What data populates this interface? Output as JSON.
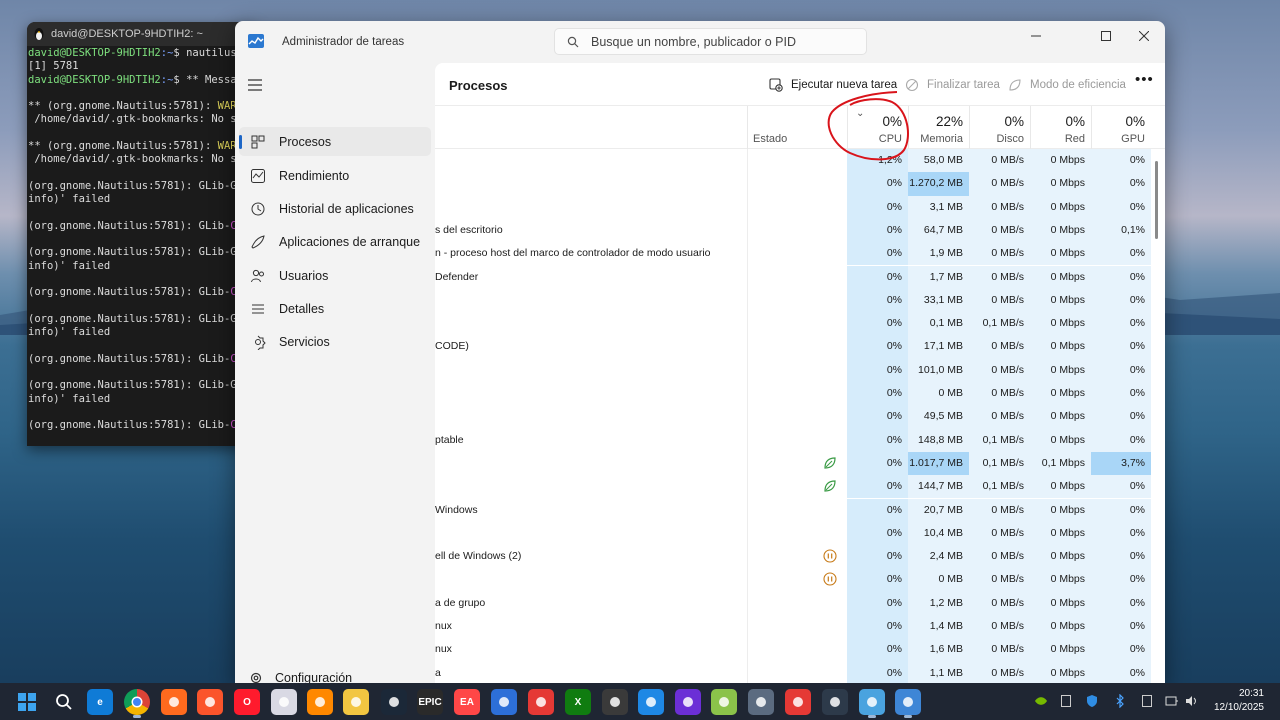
{
  "terminal": {
    "title": "david@DESKTOP-9HDTIH2: ~",
    "lines": [
      {
        "prompt_user": "david@DESKTOP-9HDTIH2",
        "prompt_path": ":~",
        "rest": "$ nautilus &"
      },
      {
        "text": "[1] 5781"
      },
      {
        "prompt_user": "david@DESKTOP-9HDTIH2",
        "prompt_path": ":~",
        "rest": "$ ** Message"
      },
      {
        "text": ""
      },
      {
        "pre": "** (org.gnome.Nautilus:5781): ",
        "warn": "WARNI"
      },
      {
        "text": " /home/david/.gtk-bookmarks: No suc"
      },
      {
        "text": ""
      },
      {
        "pre": "** (org.gnome.Nautilus:5781): ",
        "warn": "WARNI"
      },
      {
        "text": " /home/david/.gtk-bookmarks: No suc"
      },
      {
        "text": ""
      },
      {
        "pre": "(org.gnome.Nautilus:5781): GLib-GIC",
        "warn": ""
      },
      {
        "text": "info)' failed"
      },
      {
        "text": ""
      },
      {
        "pre": "(org.gnome.Nautilus:5781): GLib-",
        "crit": "CRI"
      },
      {
        "text": ""
      },
      {
        "pre": "(org.gnome.Nautilus:5781): GLib-GIC",
        "warn": ""
      },
      {
        "text": "info)' failed"
      },
      {
        "text": ""
      },
      {
        "pre": "(org.gnome.Nautilus:5781): GLib-",
        "crit": "CRI"
      },
      {
        "text": ""
      },
      {
        "pre": "(org.gnome.Nautilus:5781): GLib-GIC",
        "warn": ""
      },
      {
        "text": "info)' failed"
      },
      {
        "text": ""
      },
      {
        "pre": "(org.gnome.Nautilus:5781): GLib-",
        "crit": "CRI"
      },
      {
        "text": ""
      },
      {
        "pre": "(org.gnome.Nautilus:5781): GLib-GIC",
        "warn": ""
      },
      {
        "text": "info)' failed"
      },
      {
        "text": ""
      },
      {
        "pre": "(org.gnome.Nautilus:5781): GLib-",
        "crit": "CRI"
      }
    ]
  },
  "taskmgr": {
    "title": "Administrador de tareas",
    "search_placeholder": "Busque un nombre, publicador o PID",
    "nav": [
      {
        "label": "Procesos",
        "icon": "processes-icon",
        "active": true
      },
      {
        "label": "Rendimiento",
        "icon": "performance-icon"
      },
      {
        "label": "Historial de aplicaciones",
        "icon": "history-icon"
      },
      {
        "label": "Aplicaciones de arranque",
        "icon": "startup-icon"
      },
      {
        "label": "Usuarios",
        "icon": "users-icon"
      },
      {
        "label": "Detalles",
        "icon": "details-icon"
      },
      {
        "label": "Servicios",
        "icon": "services-icon"
      }
    ],
    "settings_label": "Configuración",
    "page_title": "Procesos",
    "toolbar": {
      "run_new_task": "Ejecutar nueva tarea",
      "end_task": "Finalizar tarea",
      "efficiency_mode": "Modo de eficiencia",
      "more": "•••"
    },
    "columns": {
      "status": "Estado",
      "cpu": {
        "pct": "0%",
        "label": "CPU"
      },
      "memory": {
        "pct": "22%",
        "label": "Memoria"
      },
      "disk": {
        "pct": "0%",
        "label": "Disco"
      },
      "network": {
        "pct": "0%",
        "label": "Red"
      },
      "gpu": {
        "pct": "0%",
        "label": "GPU"
      }
    },
    "rows": [
      {
        "name": "",
        "status": "",
        "cpu": "1,2%",
        "mem": "58,0 MB",
        "disk": "0 MB/s",
        "net": "0 Mbps",
        "gpu": "0%"
      },
      {
        "name": "",
        "status": "",
        "cpu": "0%",
        "mem": "1.270,2 MB",
        "disk": "0 MB/s",
        "net": "0 Mbps",
        "gpu": "0%",
        "mem_hl": true
      },
      {
        "name": "",
        "status": "",
        "cpu": "0%",
        "mem": "3,1 MB",
        "disk": "0 MB/s",
        "net": "0 Mbps",
        "gpu": "0%"
      },
      {
        "name": "s del escritorio",
        "status": "",
        "cpu": "0%",
        "mem": "64,7 MB",
        "disk": "0 MB/s",
        "net": "0 Mbps",
        "gpu": "0,1%"
      },
      {
        "name": "n - proceso host del marco de controlador de modo usuario",
        "status": "",
        "cpu": "0%",
        "mem": "1,9 MB",
        "disk": "0 MB/s",
        "net": "0 Mbps",
        "gpu": "0%"
      },
      {
        "name": "Defender",
        "status": "",
        "cpu": "0%",
        "mem": "1,7 MB",
        "disk": "0 MB/s",
        "net": "0 Mbps",
        "gpu": "0%"
      },
      {
        "name": "",
        "status": "",
        "cpu": "0%",
        "mem": "33,1 MB",
        "disk": "0 MB/s",
        "net": "0 Mbps",
        "gpu": "0%"
      },
      {
        "name": "",
        "status": "",
        "cpu": "0%",
        "mem": "0,1 MB",
        "disk": "0,1 MB/s",
        "net": "0 Mbps",
        "gpu": "0%"
      },
      {
        "name": "CODE)",
        "status": "",
        "cpu": "0%",
        "mem": "17,1 MB",
        "disk": "0 MB/s",
        "net": "0 Mbps",
        "gpu": "0%"
      },
      {
        "name": "",
        "status": "",
        "cpu": "0%",
        "mem": "101,0 MB",
        "disk": "0 MB/s",
        "net": "0 Mbps",
        "gpu": "0%"
      },
      {
        "name": "",
        "status": "",
        "cpu": "0%",
        "mem": "0 MB",
        "disk": "0 MB/s",
        "net": "0 Mbps",
        "gpu": "0%"
      },
      {
        "name": "",
        "status": "",
        "cpu": "0%",
        "mem": "49,5 MB",
        "disk": "0 MB/s",
        "net": "0 Mbps",
        "gpu": "0%"
      },
      {
        "name": "ptable",
        "status": "",
        "cpu": "0%",
        "mem": "148,8 MB",
        "disk": "0,1 MB/s",
        "net": "0 Mbps",
        "gpu": "0%"
      },
      {
        "name": "",
        "status": "leaf",
        "cpu": "0%",
        "mem": "1.017,7 MB",
        "disk": "0,1 MB/s",
        "net": "0,1 Mbps",
        "gpu": "3,7%",
        "mem_hl": true,
        "gpu_hl": true
      },
      {
        "name": "",
        "status": "leaf",
        "cpu": "0%",
        "mem": "144,7 MB",
        "disk": "0,1 MB/s",
        "net": "0 Mbps",
        "gpu": "0%"
      },
      {
        "name": "Windows",
        "status": "",
        "cpu": "0%",
        "mem": "20,7 MB",
        "disk": "0 MB/s",
        "net": "0 Mbps",
        "gpu": "0%"
      },
      {
        "name": "",
        "status": "",
        "cpu": "0%",
        "mem": "10,4 MB",
        "disk": "0 MB/s",
        "net": "0 Mbps",
        "gpu": "0%"
      },
      {
        "name": "ell de Windows (2)",
        "status": "pause",
        "cpu": "0%",
        "mem": "2,4 MB",
        "disk": "0 MB/s",
        "net": "0 Mbps",
        "gpu": "0%"
      },
      {
        "name": "",
        "status": "pause",
        "cpu": "0%",
        "mem": "0 MB",
        "disk": "0 MB/s",
        "net": "0 Mbps",
        "gpu": "0%"
      },
      {
        "name": "a de grupo",
        "status": "",
        "cpu": "0%",
        "mem": "1,2 MB",
        "disk": "0 MB/s",
        "net": "0 Mbps",
        "gpu": "0%"
      },
      {
        "name": "nux",
        "status": "",
        "cpu": "0%",
        "mem": "1,4 MB",
        "disk": "0 MB/s",
        "net": "0 Mbps",
        "gpu": "0%"
      },
      {
        "name": "nux",
        "status": "",
        "cpu": "0%",
        "mem": "1,6 MB",
        "disk": "0 MB/s",
        "net": "0 Mbps",
        "gpu": "0%"
      },
      {
        "name": "a",
        "status": "",
        "cpu": "0%",
        "mem": "1,1 MB",
        "disk": "0 MB/s",
        "net": "0 Mbps",
        "gpu": "0%"
      }
    ]
  },
  "taskbar": {
    "apps": [
      {
        "name": "start-icon",
        "color": "#2f8de4",
        "glyph": "",
        "active": false
      },
      {
        "name": "search-icon",
        "color": "transparent",
        "glyph": "",
        "active": false
      },
      {
        "name": "edge-icon",
        "color": "#0f7bd6",
        "glyph": "e",
        "active": false
      },
      {
        "name": "chrome-icon",
        "color": "#e8b528",
        "glyph": "",
        "active": true
      },
      {
        "name": "firefox-icon",
        "color": "#ff6a1e",
        "glyph": "",
        "active": false
      },
      {
        "name": "brave-icon",
        "color": "#fb542b",
        "glyph": "",
        "active": false
      },
      {
        "name": "opera-icon",
        "color": "#ff1b2d",
        "glyph": "O",
        "active": false
      },
      {
        "name": "parachute-icon",
        "color": "#d9d9e4",
        "glyph": "",
        "active": false
      },
      {
        "name": "vlc-icon",
        "color": "#ff8800",
        "glyph": "",
        "active": false
      },
      {
        "name": "game-character-icon",
        "color": "#f2c641",
        "glyph": "",
        "active": false
      },
      {
        "name": "steam-icon",
        "color": "#1b2838",
        "glyph": "",
        "active": false
      },
      {
        "name": "epic-games-icon",
        "color": "#2a2a2a",
        "glyph": "EPIC",
        "active": false
      },
      {
        "name": "ea-icon",
        "color": "#ff4747",
        "glyph": "EA",
        "active": false
      },
      {
        "name": "triangle-app-icon",
        "color": "#2d6fd8",
        "glyph": "",
        "active": false
      },
      {
        "name": "red-app-icon",
        "color": "#e53935",
        "glyph": "",
        "active": false
      },
      {
        "name": "xbox-icon",
        "color": "#107c10",
        "glyph": "X",
        "active": false
      },
      {
        "name": "store-icon",
        "color": "#3a3a3a",
        "glyph": "",
        "active": false
      },
      {
        "name": "sync-app-icon",
        "color": "#1e88e5",
        "glyph": "",
        "active": false
      },
      {
        "name": "purple-ring-icon",
        "color": "#6b2fd6",
        "glyph": "",
        "active": false
      },
      {
        "name": "kodi-like-icon",
        "color": "#8bc34a",
        "glyph": "",
        "active": false
      },
      {
        "name": "spiral-icon",
        "color": "#5b6b80",
        "glyph": "",
        "active": false
      },
      {
        "name": "gamepad-icon",
        "color": "#e53935",
        "glyph": "",
        "active": false
      },
      {
        "name": "terminal-app-icon",
        "color": "#2d3a4a",
        "glyph": "",
        "active": false
      },
      {
        "name": "tux-icon",
        "color": "#4aa3df",
        "glyph": "",
        "active": true
      },
      {
        "name": "taskmanager-icon",
        "color": "#3e86d6",
        "glyph": "",
        "active": true
      }
    ],
    "time": "20:31",
    "date": "12/10/2025"
  }
}
